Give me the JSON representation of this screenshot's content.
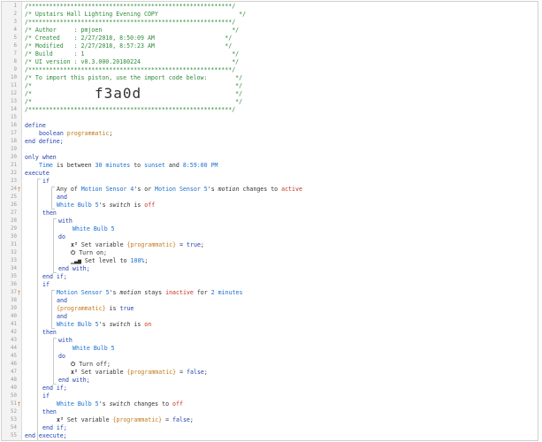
{
  "line_numbers": [
    "1",
    "2",
    "3",
    "4",
    "5",
    "6",
    "7",
    "8",
    "9",
    "10",
    "11",
    "12",
    "13",
    "14",
    "15",
    "16",
    "17",
    "18",
    "19",
    "20",
    "21",
    "22",
    "23",
    "24",
    "25",
    "26",
    "27",
    "28",
    "29",
    "30",
    "31",
    "32",
    "33",
    "34",
    "35",
    "36",
    "37",
    "38",
    "39",
    "40",
    "41",
    "42",
    "43",
    "44",
    "45",
    "46",
    "47",
    "48",
    "49",
    "50",
    "51",
    "52",
    "53",
    "54",
    "55"
  ],
  "markers": {
    "24": "†",
    "37": "†",
    "51": "†"
  },
  "header": {
    "border": "/**********************************************************/",
    "title": "/* Upstairs Hall Lighting Evening COPY                       */",
    "author": "/* Author     : pmjoen                                     */",
    "created": "/* Created    : 2/27/2018, 8:50:09 AM                    */",
    "modified": "/* Modified   : 2/27/2018, 8:57:23 AM                    */",
    "build": "/* Build      : 1                                          */",
    "ui_version": "/* UI version : v0.3.000.20180224                          */",
    "import_note": "/* To import this piston, use the import code below:        */",
    "blank": "/*                                                          */",
    "import_code": "f3a0d"
  },
  "code": {
    "define": "define",
    "boolean": "boolean",
    "programmatic": "programmatic",
    "end_define": "end define;",
    "only_when": "only when",
    "time": "Time",
    "is_between": " is between ",
    "minutes_30": "30 minutes",
    "to": " to ",
    "sunset": "sunset",
    "and_word": " and ",
    "pm_time": "8:59:00 PM",
    "execute": "execute",
    "if": "if",
    "any_of": "Any of ",
    "ms4": "Motion Sensor 4",
    "s_or": "'s or ",
    "ms5": "Motion Sensor 5",
    "s_": "'s ",
    "motion": "motion",
    "changes_to": " changes to ",
    "active": "active",
    "and": "and",
    "wb5": "White Bulb 5",
    "switch": "switch",
    "is": " is ",
    "off": "off",
    "on": "on",
    "then": "then",
    "with": "with",
    "do": "do",
    "set_variable": " Set variable ",
    "prog_var": "{programmatic}",
    "eq": " = ",
    "true": "true",
    "false": "false",
    "semi": ";",
    "turn_on": " Turn on;",
    "turn_off": " Turn off;",
    "set_level": " Set level to ",
    "pct": "100%",
    "end_with": "end with;",
    "end_if": "end if;",
    "stays": " stays ",
    "inactive": "inactive",
    "for": " for ",
    "minutes_2": "2 minutes",
    "end_execute": "end execute;"
  }
}
